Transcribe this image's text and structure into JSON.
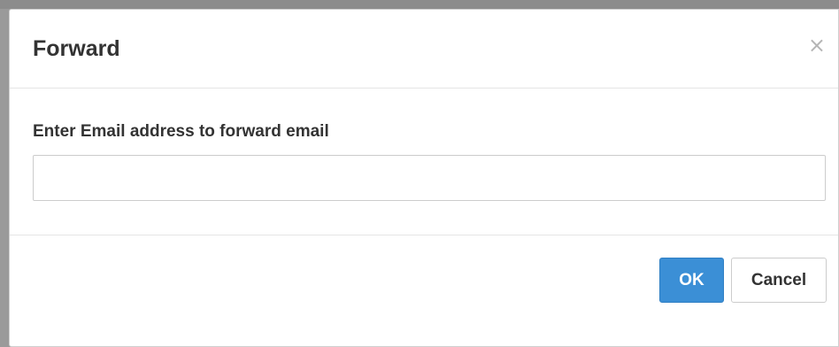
{
  "dialog": {
    "title": "Forward",
    "close_glyph": "×",
    "close_icon": "close-icon"
  },
  "form": {
    "label": "Enter Email address to forward email",
    "email_value": "",
    "email_placeholder": ""
  },
  "footer": {
    "ok_label": "OK",
    "cancel_label": "Cancel"
  },
  "colors": {
    "primary": "#3b8fd6",
    "backdrop": "#9a9a9a"
  }
}
